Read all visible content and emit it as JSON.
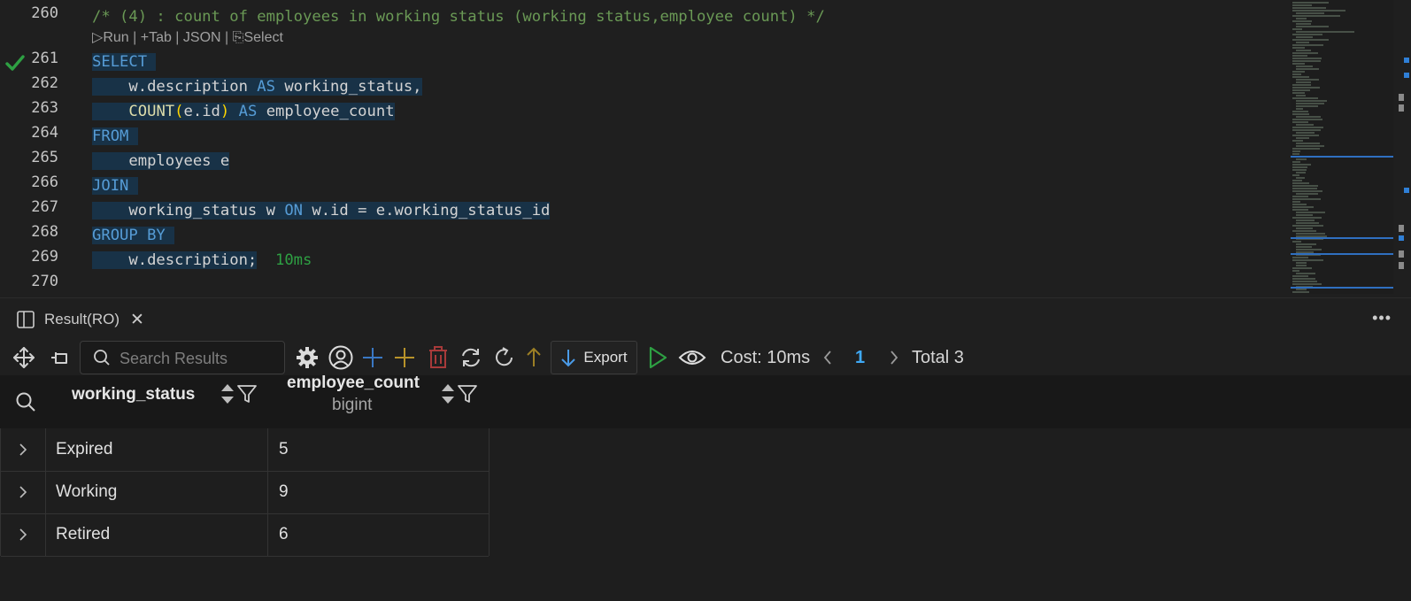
{
  "editor": {
    "line_numbers": [
      "260",
      "261",
      "262",
      "263",
      "264",
      "265",
      "266",
      "267",
      "268",
      "269",
      "270"
    ],
    "comment": "/* (4) : count of employees in working status (working status,employee count) */",
    "codelens": [
      "Run",
      "Tab",
      "JSON",
      "Select"
    ],
    "code": {
      "l261_kw": "SELECT",
      "l262_a": "    w.description ",
      "l262_kw": "AS",
      "l262_b": " working_status,",
      "l263_ind": "    ",
      "l263_fn": "COUNT",
      "l263_p1": "(",
      "l263_arg": "e.id",
      "l263_p2": ")",
      "l263_sp": " ",
      "l263_kw": "AS",
      "l263_b": " employee_count",
      "l264_kw": "FROM",
      "l265": "    employees e",
      "l266_kw": "JOIN",
      "l267_a": "    working_status w ",
      "l267_kw": "ON",
      "l267_b": " w.id = e.working_status_id",
      "l268_kw": "GROUP BY",
      "l269": "    w.description;",
      "l269_time": "10ms"
    }
  },
  "panel": {
    "tab_label": "Result(RO)",
    "search_placeholder": "Search Results",
    "export_label": "Export",
    "cost_label": "Cost: 10ms",
    "page": "1",
    "total_label": "Total 3"
  },
  "table": {
    "columns": [
      {
        "name": "working_status",
        "type": ""
      },
      {
        "name": "employee_count",
        "type": "bigint"
      }
    ],
    "rows": [
      {
        "working_status": "Expired",
        "employee_count": "5"
      },
      {
        "working_status": "Working",
        "employee_count": "9"
      },
      {
        "working_status": "Retired",
        "employee_count": "6"
      }
    ]
  },
  "colors": {
    "keyword": "#569cd6",
    "comment": "#6a9955",
    "success": "#2ea043",
    "page_number": "#3fa9f5"
  }
}
